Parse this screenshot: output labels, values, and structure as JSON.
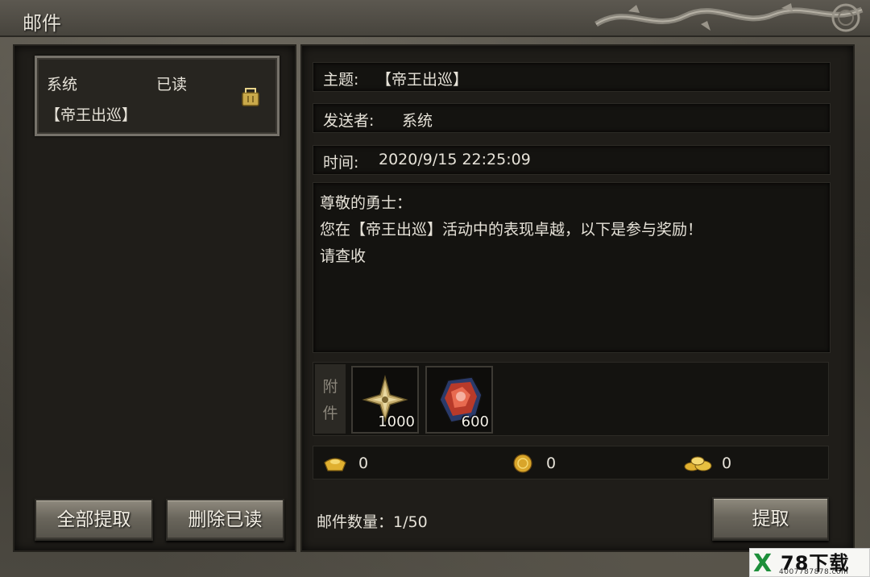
{
  "window": {
    "title": "邮件"
  },
  "mail_list": {
    "items": [
      {
        "sender": "系统",
        "status": "已读",
        "subject": "【帝王出巡】",
        "icon": "letter-icon"
      }
    ]
  },
  "left_buttons": {
    "collect_all": "全部提取",
    "delete_read": "删除已读"
  },
  "detail": {
    "subject_label": "主题:",
    "subject_value": "【帝王出巡】",
    "sender_label": "发送者:",
    "sender_value": "系统",
    "time_label": "时间:",
    "time_value": "2020/9/15 22:25:09",
    "body_lines": [
      "尊敬的勇士：",
      "您在【帝王出巡】活动中的表现卓越，以下是参与奖励！",
      "请查收"
    ]
  },
  "attachments": {
    "label_top": "附",
    "label_bottom": "件",
    "items": [
      {
        "icon": "gold-star-item-icon",
        "count": "1000"
      },
      {
        "icon": "red-gem-item-icon",
        "count": "600"
      }
    ]
  },
  "currencies": [
    {
      "icon": "gold-ingot-icon",
      "value": "0"
    },
    {
      "icon": "gold-coin-icon",
      "value": "0"
    },
    {
      "icon": "gold-pile-icon",
      "value": "0"
    }
  ],
  "footer": {
    "mail_count_label": "邮件数量：",
    "mail_count_value": "1/50",
    "collect_button": "提取"
  },
  "watermark": {
    "mark": "X",
    "main": "78下载",
    "sub": "4007787878.com"
  },
  "colors": {
    "text": "#e6e2d8",
    "panel": "#1f1d19",
    "stone": "#57534a",
    "watermark_green": "#1d8f3a"
  }
}
